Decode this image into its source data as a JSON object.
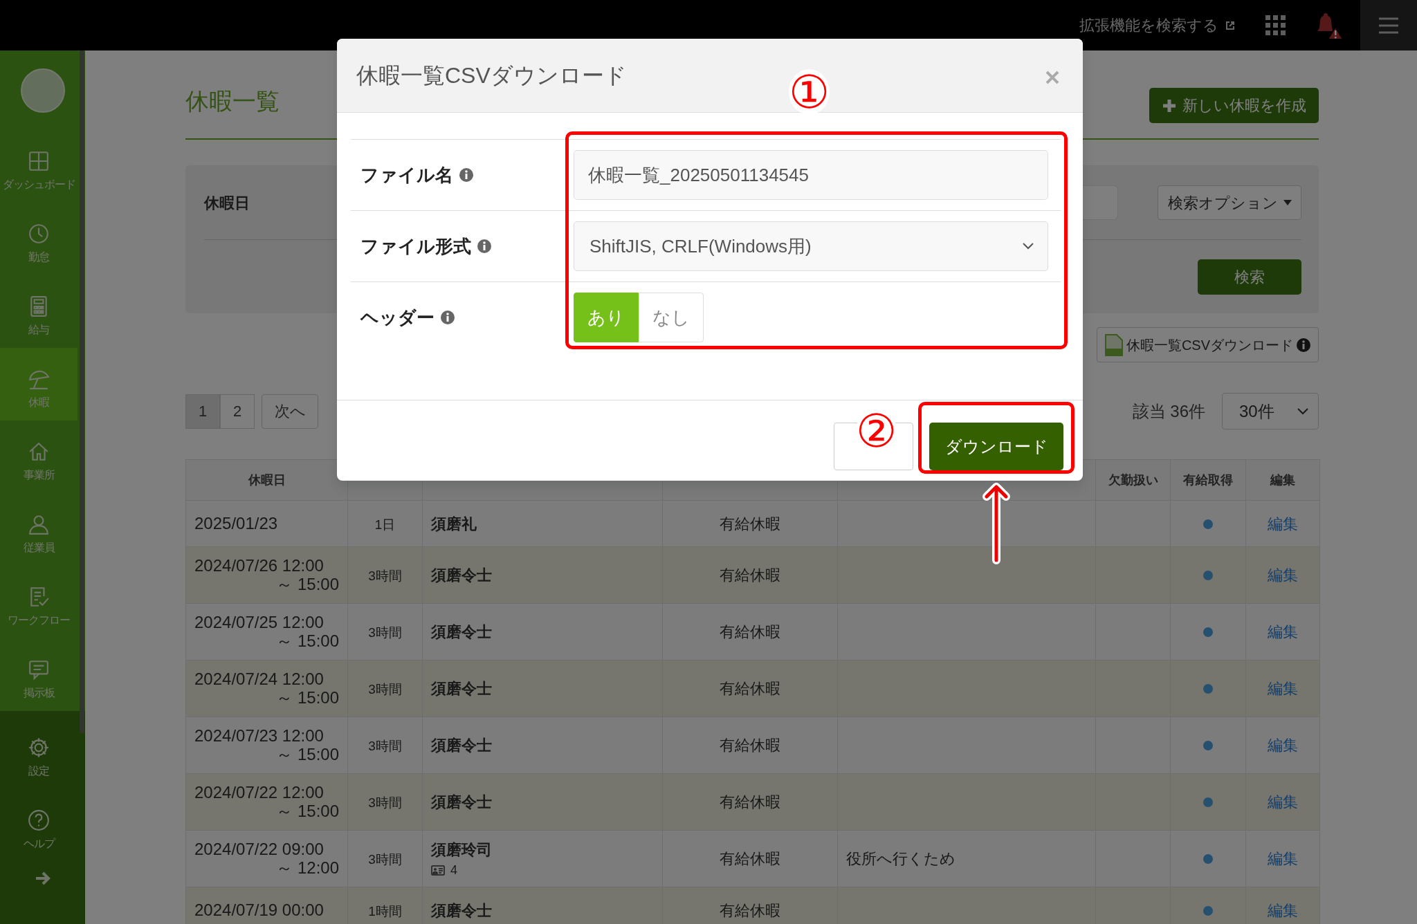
{
  "top_bar": {
    "extension_link": "拡張機能を検索する"
  },
  "sidebar": {
    "items": [
      {
        "label": "ダッシュボード",
        "selected": false
      },
      {
        "label": "勤怠",
        "selected": false
      },
      {
        "label": "給与",
        "selected": false
      },
      {
        "label": "休暇",
        "selected": true
      },
      {
        "label": "事業所",
        "selected": false
      },
      {
        "label": "従業員",
        "selected": false
      },
      {
        "label": "ワークフロー",
        "selected": false
      },
      {
        "label": "掲示板",
        "selected": false
      }
    ],
    "bottom_items": [
      {
        "label": "設定"
      },
      {
        "label": "ヘルプ"
      }
    ]
  },
  "page": {
    "title": "休暇一覧",
    "new_button": "新しい休暇を作成",
    "filter": {
      "label": "休暇日",
      "options_button": "検索オプション",
      "search_button": "検索"
    },
    "csv_button": "休暇一覧CSVダウンロード",
    "pagination": [
      {
        "label": "1",
        "selected": true
      },
      {
        "label": "2",
        "selected": false
      },
      {
        "label": "次へ",
        "selected": false
      }
    ],
    "count": "該当 36件",
    "per_page": "30件"
  },
  "table": {
    "columns": [
      "休暇日",
      null,
      null,
      null,
      null,
      "欠勤扱い",
      "有給取得",
      "編集"
    ],
    "rows": [
      {
        "date": "2025/01/23",
        "duration": "1日",
        "name": "須磨礼",
        "type": "有給休暇",
        "paid": true,
        "edit": "編集"
      },
      {
        "date": "2024/07/26 12:00",
        "date_end": "～ 15:00",
        "duration": "3時間",
        "name": "須磨令士",
        "type": "有給休暇",
        "paid": true,
        "edit": "編集"
      },
      {
        "date": "2024/07/25 12:00",
        "date_end": "～ 15:00",
        "duration": "3時間",
        "name": "須磨令士",
        "type": "有給休暇",
        "paid": true,
        "edit": "編集"
      },
      {
        "date": "2024/07/24 12:00",
        "date_end": "～ 15:00",
        "duration": "3時間",
        "name": "須磨令士",
        "type": "有給休暇",
        "paid": true,
        "edit": "編集"
      },
      {
        "date": "2024/07/23 12:00",
        "date_end": "～ 15:00",
        "duration": "3時間",
        "name": "須磨令士",
        "type": "有給休暇",
        "paid": true,
        "edit": "編集"
      },
      {
        "date": "2024/07/22 12:00",
        "date_end": "～ 15:00",
        "duration": "3時間",
        "name": "須磨令士",
        "type": "有給休暇",
        "paid": true,
        "edit": "編集"
      },
      {
        "date": "2024/07/22 09:00",
        "date_end": "～ 12:00",
        "duration": "3時間",
        "name": "須磨玲司",
        "employee_count": "4",
        "type": "有給休暇",
        "note": "役所へ行くため",
        "paid": true,
        "edit": "編集"
      },
      {
        "date": "2024/07/19 00:00",
        "duration": "1時間",
        "name": "須磨令士",
        "type": "有給休暇",
        "paid": true,
        "edit": "編集"
      }
    ]
  },
  "modal": {
    "title": "休暇一覧CSVダウンロード",
    "fields": [
      {
        "kind": "text",
        "label": "ファイル名",
        "value": "休暇一覧_20250501134545"
      },
      {
        "kind": "select",
        "label": "ファイル形式",
        "value": "ShiftJIS, CRLF(Windows用)"
      },
      {
        "kind": "toggle",
        "label": "ヘッダー",
        "options": [
          {
            "label": "あり",
            "selected": true
          },
          {
            "label": "なし",
            "selected": false
          }
        ]
      }
    ],
    "download_button": "ダウンロード"
  },
  "annotations": [
    {
      "text": "①"
    },
    {
      "text": "②"
    }
  ]
}
